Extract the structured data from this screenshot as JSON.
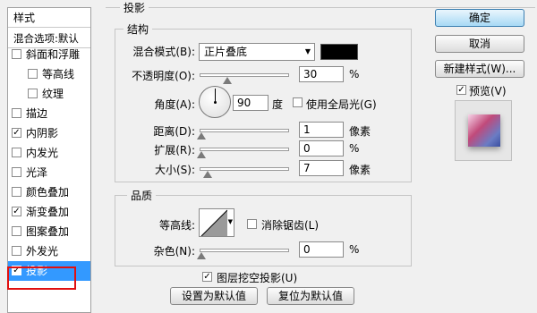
{
  "left_panel": {
    "header_styles": "样式",
    "header_blend": "混合选项:默认",
    "items": [
      {
        "label": "斜面和浮雕",
        "checked": false
      },
      {
        "label": "等高线",
        "checked": false
      },
      {
        "label": "纹理",
        "checked": false
      },
      {
        "label": "描边",
        "checked": false
      },
      {
        "label": "内阴影",
        "checked": true
      },
      {
        "label": "内发光",
        "checked": false
      },
      {
        "label": "光泽",
        "checked": false
      },
      {
        "label": "颜色叠加",
        "checked": false
      },
      {
        "label": "渐变叠加",
        "checked": true
      },
      {
        "label": "图案叠加",
        "checked": false
      },
      {
        "label": "外发光",
        "checked": false
      },
      {
        "label": "投影",
        "checked": true
      }
    ]
  },
  "panel": {
    "title": "投影",
    "structure": {
      "title": "结构",
      "blend_mode_label": "混合模式(B):",
      "blend_mode_value": "正片叠底",
      "blend_color": "#000000",
      "opacity_label": "不透明度(O):",
      "opacity_value": "30",
      "opacity_unit": "%",
      "angle_label": "角度(A):",
      "angle_value": "90",
      "angle_unit": "度",
      "global_light_label": "使用全局光(G)",
      "distance_label": "距离(D):",
      "distance_value": "1",
      "distance_unit": "像素",
      "spread_label": "扩展(R):",
      "spread_value": "0",
      "spread_unit": "%",
      "size_label": "大小(S):",
      "size_value": "7",
      "size_unit": "像素"
    },
    "quality": {
      "title": "品质",
      "contour_label": "等高线:",
      "antialias_label": "消除锯齿(L)",
      "noise_label": "杂色(N):",
      "noise_value": "0",
      "noise_unit": "%"
    },
    "knockout_label": "图层挖空投影(U)",
    "make_default": "设置为默认值",
    "reset_default": "复位为默认值"
  },
  "right": {
    "ok": "确定",
    "cancel": "取消",
    "new_style": "新建样式(W)...",
    "preview_label": "预览(V)"
  },
  "icons": {
    "check": "✓",
    "dropdown": "▼"
  },
  "colors": {
    "selected_bg": "#3399ff",
    "highlight_border": "#e01010"
  }
}
